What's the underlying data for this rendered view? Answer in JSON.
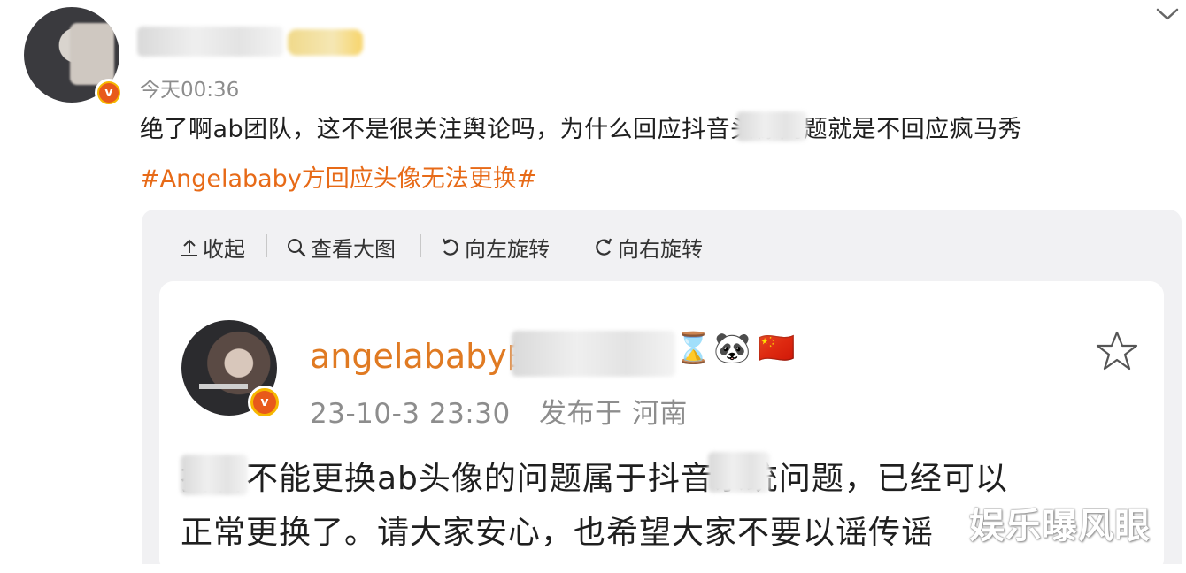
{
  "post": {
    "time": "今天00:36",
    "text": "绝了啊ab团队，这不是很关注舆论吗，为什么回应抖音头像问题就是不回应疯马秀",
    "hashtag": "#Angelababy方回应头像无法更换#"
  },
  "toolbar": {
    "collapse": "收起",
    "view_large": "查看大图",
    "rotate_left": "向左旋转",
    "rotate_right": "向右旋转"
  },
  "quoted": {
    "name": "angelababy的",
    "emojis": [
      "⌛",
      "🐼",
      "🇨🇳"
    ],
    "time": "23-10-3 23:30",
    "location": "发布于 河南",
    "body_line1": "抖音不能更换ab头像的问题属于抖音系统问题，已经可以",
    "body_line2": "正常更换了。请大家安心，也希望大家不要以谣传谣"
  },
  "watermark": "娱乐曝风眼",
  "colors": {
    "hashtag": "#e76a17",
    "name": "#e07a22",
    "verified": "#e8591a",
    "meta": "#8d8d8d"
  }
}
